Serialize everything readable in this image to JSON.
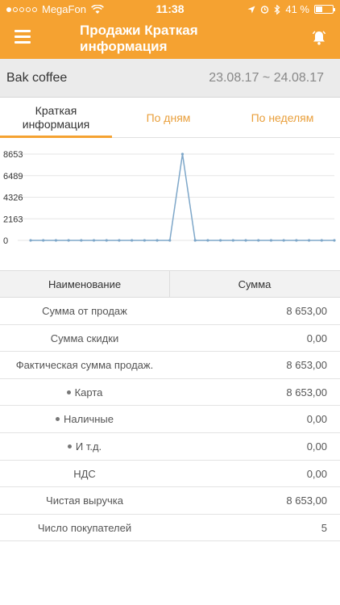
{
  "status_bar": {
    "carrier": "MegaFon",
    "time": "11:38",
    "battery": "41 %",
    "battery_level": 0.41
  },
  "header": {
    "title_line1": "Продажи Краткая",
    "title_line2": "информация"
  },
  "store": {
    "name": "Bak coffee",
    "date_from": "23.08.17",
    "separator": "~",
    "date_to": "24.08.17"
  },
  "tabs": [
    {
      "label_line1": "Краткая",
      "label_line2": "информация",
      "active": true
    },
    {
      "label": "По дням",
      "active": false
    },
    {
      "label": "По неделям",
      "active": false
    }
  ],
  "chart_data": {
    "type": "line",
    "y_ticks": [
      "8653",
      "6489",
      "4326",
      "2163",
      "0"
    ],
    "ylim": [
      0,
      8653
    ],
    "values": [
      0,
      0,
      0,
      0,
      0,
      0,
      0,
      0,
      0,
      0,
      0,
      0,
      8653,
      0,
      0,
      0,
      0,
      0,
      0,
      0,
      0,
      0,
      0,
      0,
      0
    ],
    "line_color": "#7ea7c9",
    "grid": true
  },
  "table": {
    "headers": {
      "name": "Наименование",
      "sum": "Сумма"
    },
    "rows": [
      {
        "name": "Сумма от продаж",
        "value": "8 653,00",
        "bullet": false
      },
      {
        "name": "Сумма скидки",
        "value": "0,00",
        "bullet": false
      },
      {
        "name": "Фактическая сумма продаж.",
        "value": "8 653,00",
        "bullet": false
      },
      {
        "name": "Карта",
        "value": "8 653,00",
        "bullet": true
      },
      {
        "name": "Наличные",
        "value": "0,00",
        "bullet": true
      },
      {
        "name": "И т.д.",
        "value": "0,00",
        "bullet": true
      },
      {
        "name": "НДС",
        "value": "0,00",
        "bullet": false
      },
      {
        "name": "Чистая выручка",
        "value": "8 653,00",
        "bullet": false
      },
      {
        "name": "Число покупателей",
        "value": "5",
        "bullet": false
      }
    ]
  },
  "colors": {
    "accent": "#f5a231",
    "tab_inactive": "#e99f3b"
  }
}
